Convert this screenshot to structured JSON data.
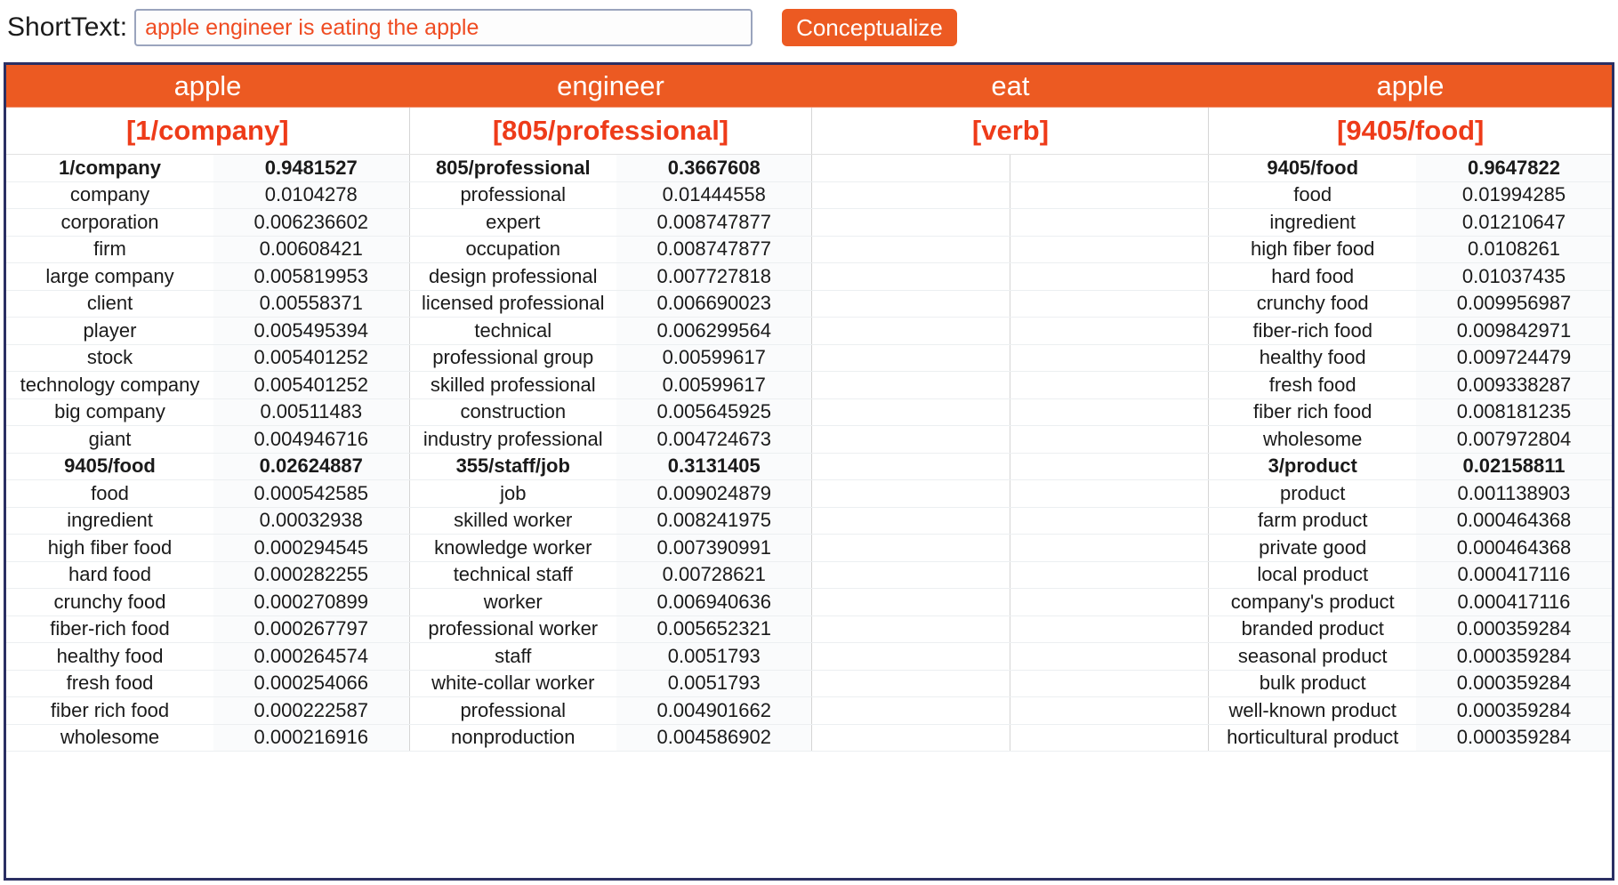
{
  "topbar": {
    "label": "ShortText:",
    "input_value": "apple engineer is eating the apple",
    "input_placeholder": "",
    "button_label": "Conceptualize"
  },
  "colors": {
    "accent": "#ec5a22",
    "sense_text": "#ee3b19",
    "border": "#2b2f63",
    "input_text": "#ef4b21"
  },
  "table": {
    "words": [
      "apple",
      "engineer",
      "eat",
      "apple"
    ],
    "senses": [
      "[1/company]",
      "[805/professional]",
      "[verb]",
      "[9405/food]"
    ],
    "columns": [
      {
        "word": "apple",
        "sense": "[1/company]",
        "rows": [
          {
            "term": "1/company",
            "score": "0.9481527",
            "head": true
          },
          {
            "term": "company",
            "score": "0.0104278",
            "head": false
          },
          {
            "term": "corporation",
            "score": "0.006236602",
            "head": false
          },
          {
            "term": "firm",
            "score": "0.00608421",
            "head": false
          },
          {
            "term": "large company",
            "score": "0.005819953",
            "head": false
          },
          {
            "term": "client",
            "score": "0.00558371",
            "head": false
          },
          {
            "term": "player",
            "score": "0.005495394",
            "head": false
          },
          {
            "term": "stock",
            "score": "0.005401252",
            "head": false
          },
          {
            "term": "technology company",
            "score": "0.005401252",
            "head": false
          },
          {
            "term": "big company",
            "score": "0.00511483",
            "head": false
          },
          {
            "term": "giant",
            "score": "0.004946716",
            "head": false
          },
          {
            "term": "9405/food",
            "score": "0.02624887",
            "head": true
          },
          {
            "term": "food",
            "score": "0.000542585",
            "head": false
          },
          {
            "term": "ingredient",
            "score": "0.00032938",
            "head": false
          },
          {
            "term": "high fiber food",
            "score": "0.000294545",
            "head": false
          },
          {
            "term": "hard food",
            "score": "0.000282255",
            "head": false
          },
          {
            "term": "crunchy food",
            "score": "0.000270899",
            "head": false
          },
          {
            "term": "fiber-rich food",
            "score": "0.000267797",
            "head": false
          },
          {
            "term": "healthy food",
            "score": "0.000264574",
            "head": false
          },
          {
            "term": "fresh food",
            "score": "0.000254066",
            "head": false
          },
          {
            "term": "fiber rich food",
            "score": "0.000222587",
            "head": false
          },
          {
            "term": "wholesome",
            "score": "0.000216916",
            "head": false
          }
        ]
      },
      {
        "word": "engineer",
        "sense": "[805/professional]",
        "rows": [
          {
            "term": "805/professional",
            "score": "0.3667608",
            "head": true
          },
          {
            "term": "professional",
            "score": "0.01444558",
            "head": false
          },
          {
            "term": "expert",
            "score": "0.008747877",
            "head": false
          },
          {
            "term": "occupation",
            "score": "0.008747877",
            "head": false
          },
          {
            "term": "design professional",
            "score": "0.007727818",
            "head": false
          },
          {
            "term": "licensed professional",
            "score": "0.006690023",
            "head": false
          },
          {
            "term": "technical",
            "score": "0.006299564",
            "head": false
          },
          {
            "term": "professional group",
            "score": "0.00599617",
            "head": false
          },
          {
            "term": "skilled professional",
            "score": "0.00599617",
            "head": false
          },
          {
            "term": "construction",
            "score": "0.005645925",
            "head": false
          },
          {
            "term": "industry professional",
            "score": "0.004724673",
            "head": false
          },
          {
            "term": "355/staff/job",
            "score": "0.3131405",
            "head": true
          },
          {
            "term": "job",
            "score": "0.009024879",
            "head": false
          },
          {
            "term": "skilled worker",
            "score": "0.008241975",
            "head": false
          },
          {
            "term": "knowledge worker",
            "score": "0.007390991",
            "head": false
          },
          {
            "term": "technical staff",
            "score": "0.00728621",
            "head": false
          },
          {
            "term": "worker",
            "score": "0.006940636",
            "head": false
          },
          {
            "term": "professional worker",
            "score": "0.005652321",
            "head": false
          },
          {
            "term": "staff",
            "score": "0.0051793",
            "head": false
          },
          {
            "term": "white-collar worker",
            "score": "0.0051793",
            "head": false
          },
          {
            "term": "professional",
            "score": "0.004901662",
            "head": false
          },
          {
            "term": "nonproduction",
            "score": "0.004586902",
            "head": false
          }
        ]
      },
      {
        "word": "eat",
        "sense": "[verb]",
        "rows": [
          {
            "term": "",
            "score": "",
            "head": false
          },
          {
            "term": "",
            "score": "",
            "head": false
          },
          {
            "term": "",
            "score": "",
            "head": false
          },
          {
            "term": "",
            "score": "",
            "head": false
          },
          {
            "term": "",
            "score": "",
            "head": false
          },
          {
            "term": "",
            "score": "",
            "head": false
          },
          {
            "term": "",
            "score": "",
            "head": false
          },
          {
            "term": "",
            "score": "",
            "head": false
          },
          {
            "term": "",
            "score": "",
            "head": false
          },
          {
            "term": "",
            "score": "",
            "head": false
          },
          {
            "term": "",
            "score": "",
            "head": false
          },
          {
            "term": "",
            "score": "",
            "head": false
          },
          {
            "term": "",
            "score": "",
            "head": false
          },
          {
            "term": "",
            "score": "",
            "head": false
          },
          {
            "term": "",
            "score": "",
            "head": false
          },
          {
            "term": "",
            "score": "",
            "head": false
          },
          {
            "term": "",
            "score": "",
            "head": false
          },
          {
            "term": "",
            "score": "",
            "head": false
          },
          {
            "term": "",
            "score": "",
            "head": false
          },
          {
            "term": "",
            "score": "",
            "head": false
          },
          {
            "term": "",
            "score": "",
            "head": false
          },
          {
            "term": "",
            "score": "",
            "head": false
          }
        ]
      },
      {
        "word": "apple",
        "sense": "[9405/food]",
        "rows": [
          {
            "term": "9405/food",
            "score": "0.9647822",
            "head": true
          },
          {
            "term": "food",
            "score": "0.01994285",
            "head": false
          },
          {
            "term": "ingredient",
            "score": "0.01210647",
            "head": false
          },
          {
            "term": "high fiber food",
            "score": "0.0108261",
            "head": false
          },
          {
            "term": "hard food",
            "score": "0.01037435",
            "head": false
          },
          {
            "term": "crunchy food",
            "score": "0.009956987",
            "head": false
          },
          {
            "term": "fiber-rich food",
            "score": "0.009842971",
            "head": false
          },
          {
            "term": "healthy food",
            "score": "0.009724479",
            "head": false
          },
          {
            "term": "fresh food",
            "score": "0.009338287",
            "head": false
          },
          {
            "term": "fiber rich food",
            "score": "0.008181235",
            "head": false
          },
          {
            "term": "wholesome",
            "score": "0.007972804",
            "head": false
          },
          {
            "term": "3/product",
            "score": "0.02158811",
            "head": true
          },
          {
            "term": "product",
            "score": "0.001138903",
            "head": false
          },
          {
            "term": "farm product",
            "score": "0.000464368",
            "head": false
          },
          {
            "term": "private good",
            "score": "0.000464368",
            "head": false
          },
          {
            "term": "local product",
            "score": "0.000417116",
            "head": false
          },
          {
            "term": "company's product",
            "score": "0.000417116",
            "head": false
          },
          {
            "term": "branded product",
            "score": "0.000359284",
            "head": false
          },
          {
            "term": "seasonal product",
            "score": "0.000359284",
            "head": false
          },
          {
            "term": "bulk product",
            "score": "0.000359284",
            "head": false
          },
          {
            "term": "well-known product",
            "score": "0.000359284",
            "head": false
          },
          {
            "term": "horticultural product",
            "score": "0.000359284",
            "head": false
          }
        ]
      }
    ]
  }
}
